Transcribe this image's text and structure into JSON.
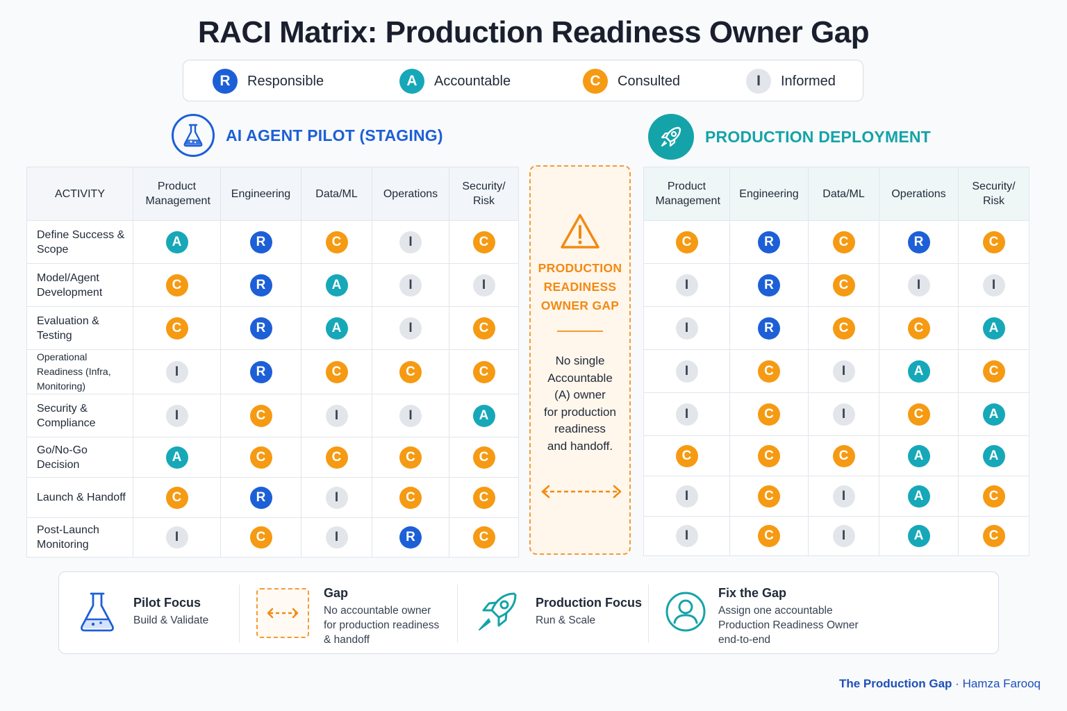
{
  "title": "RACI Matrix: Production Readiness Owner Gap",
  "legend": [
    {
      "code": "R",
      "label": "Responsible"
    },
    {
      "code": "A",
      "label": "Accountable"
    },
    {
      "code": "C",
      "label": "Consulted"
    },
    {
      "code": "I",
      "label": "Informed"
    }
  ],
  "colors": {
    "R": "#1d5fd6",
    "A": "#16a8b8",
    "C": "#f59a12",
    "I": "#e2e5ea",
    "pilot_heading": "#1d5fd6",
    "production_heading": "#14a3a8",
    "gap": "#f28a12",
    "footer": "#1d4fb8"
  },
  "pilot": {
    "heading": "AI AGENT PILOT (STAGING)",
    "icon": "flask-icon",
    "activity_header": "ACTIVITY",
    "columns": [
      "Product Management",
      "Engineering",
      "Data/ML",
      "Operations",
      "Security/ Risk"
    ],
    "activities": [
      "Define Success & Scope",
      "Model/Agent Development",
      "Evaluation & Testing",
      "Operational Readiness (Infra, Monitoring)",
      "Security & Compliance",
      "Go/No-Go Decision",
      "Launch & Handoff",
      "Post-Launch Monitoring"
    ],
    "matrix": [
      [
        "A",
        "R",
        "C",
        "I",
        "C"
      ],
      [
        "C",
        "R",
        "A",
        "I",
        "I"
      ],
      [
        "C",
        "R",
        "A",
        "I",
        "C"
      ],
      [
        "I",
        "R",
        "C",
        "C",
        "C"
      ],
      [
        "I",
        "C",
        "I",
        "I",
        "A"
      ],
      [
        "A",
        "C",
        "C",
        "C",
        "C"
      ],
      [
        "C",
        "R",
        "I",
        "C",
        "C"
      ],
      [
        "I",
        "C",
        "I",
        "R",
        "C"
      ]
    ]
  },
  "production": {
    "heading": "PRODUCTION DEPLOYMENT",
    "icon": "rocket-icon",
    "columns": [
      "Product Management",
      "Engineering",
      "Data/ML",
      "Operations",
      "Security/ Risk"
    ],
    "matrix": [
      [
        "C",
        "R",
        "C",
        "R",
        "C"
      ],
      [
        "I",
        "R",
        "C",
        "I",
        "I"
      ],
      [
        "I",
        "R",
        "C",
        "C",
        "A"
      ],
      [
        "I",
        "C",
        "I",
        "A",
        "C"
      ],
      [
        "I",
        "C",
        "I",
        "C",
        "A"
      ],
      [
        "C",
        "C",
        "C",
        "A",
        "A"
      ],
      [
        "I",
        "C",
        "I",
        "A",
        "C"
      ],
      [
        "I",
        "C",
        "I",
        "A",
        "C"
      ]
    ]
  },
  "gap": {
    "icon": "warning-icon",
    "title_lines": [
      "PRODUCTION",
      "READINESS",
      "OWNER GAP"
    ],
    "description_lines": [
      "No single",
      "Accountable",
      "(A) owner",
      "for production",
      "readiness",
      "and handoff."
    ],
    "arrow_icon": "double-arrow-icon"
  },
  "bottom": [
    {
      "icon": "flask-icon",
      "title": "Pilot Focus",
      "subtitle_lines": [
        "Build & Validate"
      ]
    },
    {
      "icon": "double-arrow-icon",
      "title": "Gap",
      "subtitle_lines": [
        "No accountable owner",
        "for production readiness",
        "& handoff"
      ]
    },
    {
      "icon": "rocket-icon",
      "title": "Production Focus",
      "subtitle_lines": [
        "Run & Scale"
      ]
    },
    {
      "icon": "user-icon",
      "title": "Fix the Gap",
      "subtitle_lines": [
        "Assign one accountable",
        "Production Readiness Owner",
        "end-to-end"
      ]
    }
  ],
  "footer": {
    "series": "The Production Gap",
    "separator": "·",
    "author": "Hamza Farooq"
  }
}
